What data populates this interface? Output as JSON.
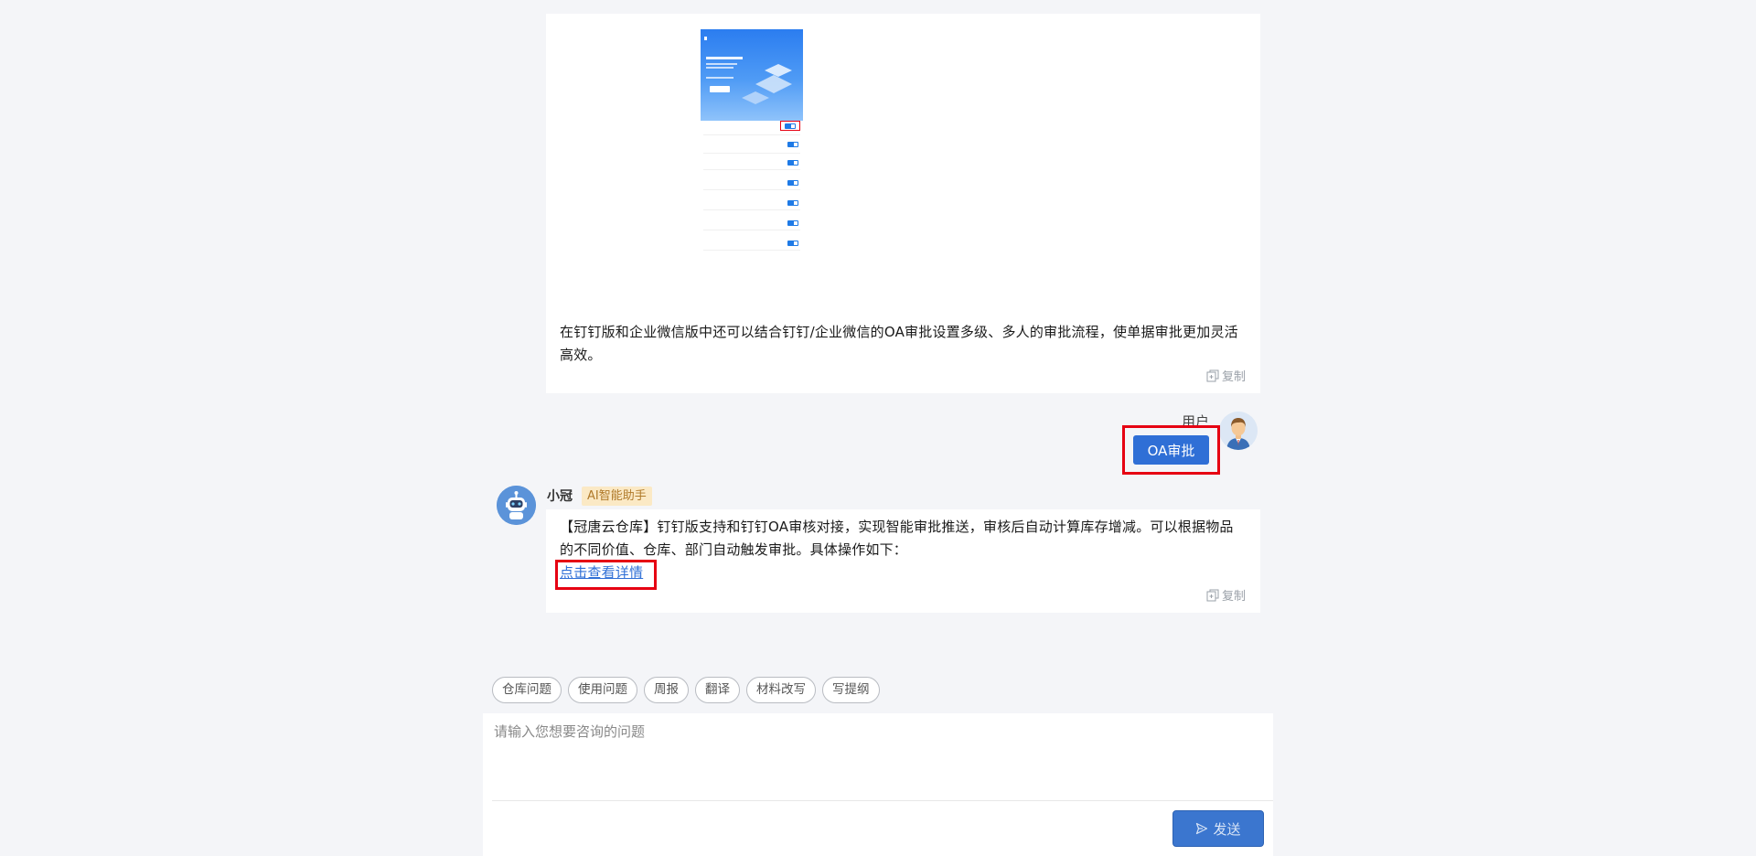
{
  "message1": {
    "text": "在钉钉版和企业微信版中还可以结合钉钉/企业微信的OA审批设置多级、多人的审批流程，使单据审批更加灵活高效。",
    "copy_label": "复制"
  },
  "user_message": {
    "name": "用户",
    "text": "OA审批"
  },
  "assistant": {
    "name": "小冠",
    "badge": "AI智能助手",
    "text": "【冠唐云仓库】钉钉版支持和钉钉OA审核对接，实现智能审批推送，审核后自动计算库存增减。可以根据物品的不同价值、仓库、部门自动触发审批。具体操作如下：",
    "link_text": "点击查看详情",
    "copy_label": "复制"
  },
  "chips": [
    "仓库问题",
    "使用问题",
    "周报",
    "翻译",
    "材料改写",
    "写提纲"
  ],
  "composer": {
    "placeholder": "请输入您想要咨询的问题",
    "send_label": "发送"
  },
  "colors": {
    "accent": "#2f6fd6",
    "highlight": "#e60012",
    "badge_bg": "#fbe9c5",
    "badge_text": "#b07a2a"
  }
}
